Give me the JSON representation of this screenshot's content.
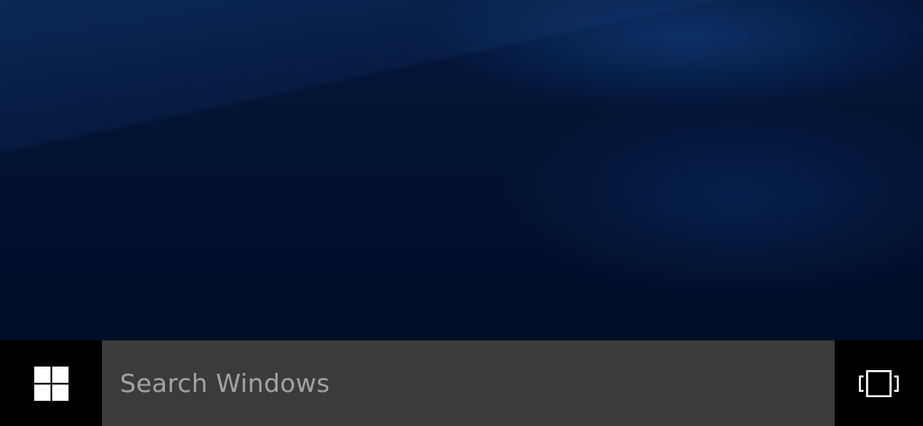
{
  "taskbar": {
    "start_icon": "windows-logo-icon",
    "search": {
      "placeholder": "Search Windows"
    },
    "task_view_icon": "task-view-icon"
  },
  "colors": {
    "taskbar_background": "#000000",
    "search_background": "#3b3b3b",
    "search_text": "#a3a3a3",
    "icon": "#ffffff",
    "desktop_background": "#021232"
  }
}
